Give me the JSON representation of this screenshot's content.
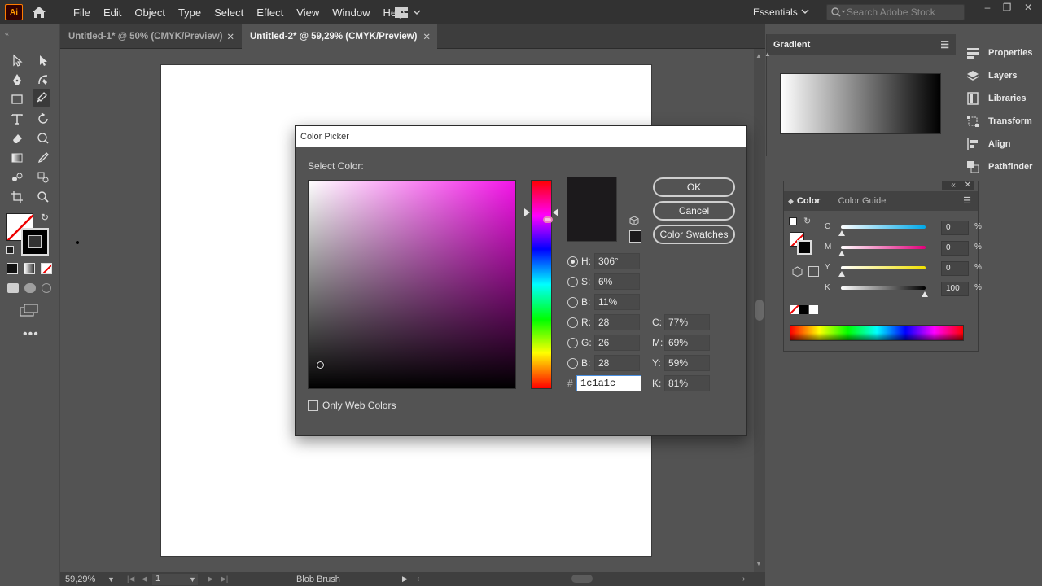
{
  "app": {
    "logo": "Ai"
  },
  "menu": [
    "File",
    "Edit",
    "Object",
    "Type",
    "Select",
    "Effect",
    "View",
    "Window",
    "Help"
  ],
  "workspace": "Essentials",
  "search": {
    "placeholder": "Search Adobe Stock"
  },
  "tabs": [
    {
      "label": "Untitled-1* @ 50% (CMYK/Preview)",
      "active": false
    },
    {
      "label": "Untitled-2* @ 59,29% (CMYK/Preview)",
      "active": true
    }
  ],
  "status": {
    "zoom": "59,29%",
    "artboard": "1",
    "tool": "Blob Brush"
  },
  "gradient_panel": {
    "title": "Gradient"
  },
  "right_panels": [
    "Properties",
    "Layers",
    "Libraries",
    "Transform",
    "Align",
    "Pathfinder"
  ],
  "color_panel": {
    "tabs": [
      "Color",
      "Color Guide"
    ],
    "sliders": [
      {
        "label": "C",
        "value": "0",
        "unit": "%"
      },
      {
        "label": "M",
        "value": "0",
        "unit": "%"
      },
      {
        "label": "Y",
        "value": "0",
        "unit": "%"
      },
      {
        "label": "K",
        "value": "100",
        "unit": "%"
      }
    ]
  },
  "picker": {
    "title": "Color Picker",
    "select_label": "Select Color:",
    "buttons": {
      "ok": "OK",
      "cancel": "Cancel",
      "swatches": "Color Swatches"
    },
    "hsb": [
      {
        "label": "H:",
        "value": "306°"
      },
      {
        "label": "S:",
        "value": "6%"
      },
      {
        "label": "B:",
        "value": "11%"
      }
    ],
    "rgb": [
      {
        "label": "R:",
        "value": "28"
      },
      {
        "label": "G:",
        "value": "26"
      },
      {
        "label": "B:",
        "value": "28"
      }
    ],
    "cmyk": [
      {
        "label": "C:",
        "value": "77%"
      },
      {
        "label": "M:",
        "value": "69%"
      },
      {
        "label": "Y:",
        "value": "59%"
      },
      {
        "label": "K:",
        "value": "81%"
      }
    ],
    "hex_label": "#",
    "hex": "1c1a1c",
    "web_colors_label": "Only Web Colors",
    "current_color": "#1c1a1c"
  }
}
